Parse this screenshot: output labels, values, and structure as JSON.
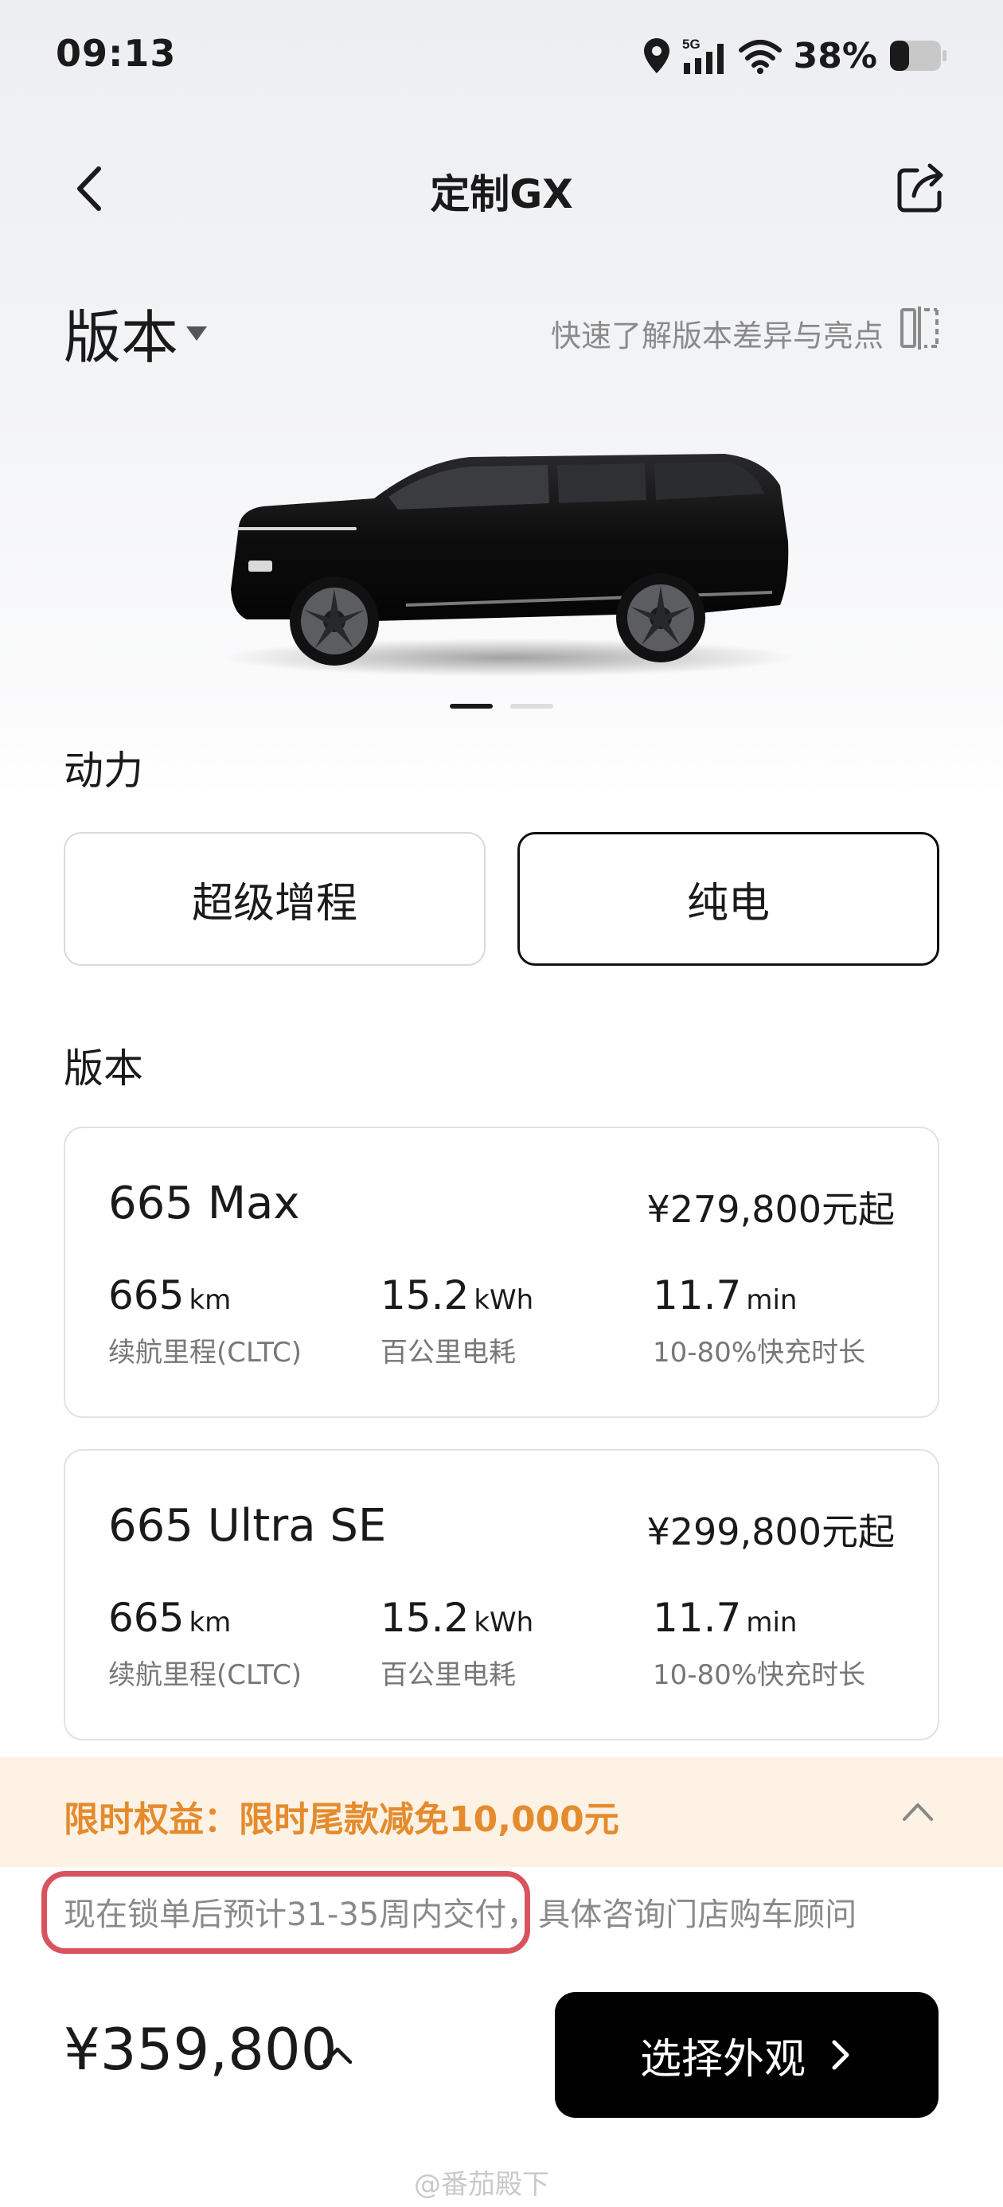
{
  "status_bar": {
    "time": "09:13",
    "network": "5G",
    "battery": "38%",
    "icons": [
      "location-icon",
      "signal-icon",
      "wifi-icon",
      "battery-icon"
    ]
  },
  "header": {
    "title": "定制GX",
    "back_icon": "chevron-left-icon",
    "share_icon": "share-icon"
  },
  "version_section": {
    "heading": "版本",
    "compare_link": "快速了解版本差异与亮点"
  },
  "carousel": {
    "total": 2,
    "active_index": 0
  },
  "power": {
    "label": "动力",
    "options": [
      {
        "label": "超级增程",
        "selected": false
      },
      {
        "label": "纯电",
        "selected": true
      }
    ]
  },
  "trims": {
    "label": "版本",
    "items": [
      {
        "name": "665 Max",
        "price": "¥279,800元起",
        "specs": [
          {
            "value": "665",
            "unit": "km",
            "caption": "续航里程(CLTC)"
          },
          {
            "value": "15.2",
            "unit": "kWh",
            "caption": "百公里电耗"
          },
          {
            "value": "11.7",
            "unit": "min",
            "caption": "10-80%快充时长"
          }
        ]
      },
      {
        "name": "665 Ultra SE",
        "price": "¥299,800元起",
        "specs": [
          {
            "value": "665",
            "unit": "km",
            "caption": "续航里程(CLTC)"
          },
          {
            "value": "15.2",
            "unit": "kWh",
            "caption": "百公里电耗"
          },
          {
            "value": "11.7",
            "unit": "min",
            "caption": "10-80%快充时长"
          }
        ]
      }
    ]
  },
  "promo": {
    "text": "限时权益：限时尾款减免10,000元"
  },
  "delivery_note": "现在锁单后预计31-35周内交付，具体咨询门店购车顾问",
  "bottom_bar": {
    "total_price": "¥359,800",
    "cta": "选择外观"
  },
  "watermark": "@番茄殿下",
  "colors": {
    "accent_orange": "#e48b2e",
    "promo_bg": "#fdf2e4",
    "highlight_red": "#d8525f",
    "cta_bg": "#000000"
  }
}
